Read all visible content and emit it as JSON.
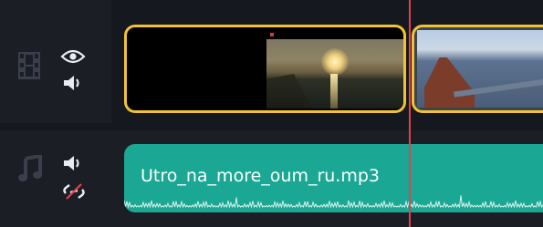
{
  "video_track": {
    "icons": {
      "film": "film-strip-icon",
      "eye": "eye-icon",
      "speaker": "speaker-icon"
    },
    "clips": [
      {
        "name": "sunset-clip",
        "selected": true
      },
      {
        "name": "pier-clip",
        "selected": true
      }
    ]
  },
  "audio_track": {
    "icons": {
      "music": "music-note-icon",
      "speaker": "speaker-icon",
      "unlink": "unlink-icon"
    },
    "clip_title": "Utro_na_more_oum_ru.mp3"
  },
  "colors": {
    "selection_border": "#f2c230",
    "audio_clip": "#1aa794",
    "playhead": "#e2424a",
    "header_bg": "#1b1e25"
  }
}
